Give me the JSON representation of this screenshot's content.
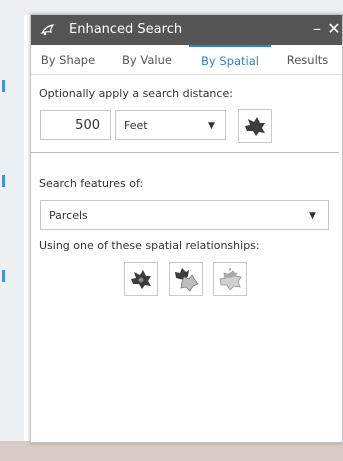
{
  "window": {
    "title": "Enhanced Search",
    "minimize_glyph": "–",
    "close_glyph": "✕"
  },
  "tabs": [
    {
      "label": "By Shape",
      "active": false
    },
    {
      "label": "By Value",
      "active": false
    },
    {
      "label": "By Spatial",
      "active": true
    },
    {
      "label": "Results",
      "active": false
    }
  ],
  "distance": {
    "prompt": "Optionally apply a search distance:",
    "value": "500",
    "units_selected": "Feet"
  },
  "layer": {
    "prompt": "Search features of:",
    "selected": "Parcels"
  },
  "relationships": {
    "prompt": "Using one of these spatial relationships:",
    "icons": [
      "intersects-shape-icon",
      "overlaps-shapes-icon",
      "touches-shapes-icon"
    ]
  },
  "colors": {
    "titlebar": "#555555",
    "accent": "#3a7fc1",
    "icon_dark": "#3c3c3c",
    "icon_light": "#bdbdbd"
  }
}
